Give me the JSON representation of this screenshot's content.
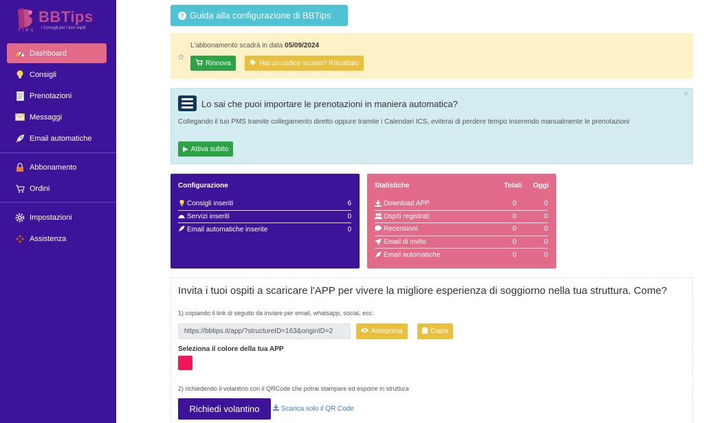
{
  "brand": {
    "name": "BBTips",
    "tagline": "i Consigli per i tuoi ospiti",
    "tips": "TIPS",
    "logo_color": "#c14c8e"
  },
  "sidebar": {
    "groups": [
      [
        {
          "label": "Dashboard",
          "icon": "dashboard-icon",
          "active": true
        },
        {
          "label": "Consigli",
          "icon": "lightbulb-icon"
        },
        {
          "label": "Prenotazioni",
          "icon": "document-icon"
        },
        {
          "label": "Messaggi",
          "icon": "envelope-icon"
        },
        {
          "label": "Email automatiche",
          "icon": "rocket-icon"
        }
      ],
      [
        {
          "label": "Abbonamento",
          "icon": "lock-icon"
        },
        {
          "label": "Ordini",
          "icon": "cart-icon"
        }
      ],
      [
        {
          "label": "Impostazioni",
          "icon": "gear-icon"
        },
        {
          "label": "Assistenza",
          "icon": "support-icon"
        }
      ]
    ]
  },
  "guide_button": "Guida alla configurazione di BBTips",
  "subscription": {
    "message": "L'abbonamento scadrà in data",
    "date": "05/09/2024",
    "renew_label": "Rinnova",
    "promo_label": "Hai un codice sconto? Riscattalo"
  },
  "import_alert": {
    "title": "Lo sai che puoi importare le prenotazioni in maniera automatica?",
    "body": "Collegando il tuo PMS tramite collegamento diretto oppure tramite i Calendari ICS, eviterai di perdere tempo inserendo manualmente le prenotazioni",
    "action_label": "Attiva subito",
    "close": "×"
  },
  "config_card": {
    "title": "Configurazione",
    "rows": [
      {
        "label": "Consigli inseriti",
        "value": "6",
        "icon": "lightbulb-icon"
      },
      {
        "label": "Servizi inseriti",
        "value": "0",
        "icon": "bell-icon"
      },
      {
        "label": "Email automatiche inserite",
        "value": "0",
        "icon": "rocket-icon"
      }
    ]
  },
  "stats_card": {
    "title": "Statistiche",
    "col_total": "Totali",
    "col_today": "Oggi",
    "rows": [
      {
        "label": "Download APP",
        "total": "0",
        "today": "0",
        "icon": "download-icon"
      },
      {
        "label": "Ospiti registrati",
        "total": "0",
        "today": "0",
        "icon": "users-icon"
      },
      {
        "label": "Recensioni",
        "total": "0",
        "today": "0",
        "icon": "comment-icon"
      },
      {
        "label": "Email di invito",
        "total": "0",
        "today": "0",
        "icon": "send-icon"
      },
      {
        "label": "Email automatiche",
        "total": "0",
        "today": "0",
        "icon": "rocket-icon"
      }
    ]
  },
  "invite": {
    "title": "Invita i tuoi ospiti a scaricare l'APP per vivere la migliore esperienza di soggiorno nella tua struttura. Come?",
    "step1": "1) copiando il link di seguito da inviare per email, whatsapp, social, ecc.",
    "link": "https://bbtips.it/app/?structureID=163&originID=2",
    "preview_label": "Anteprima",
    "copy_label": "Copia",
    "color_label": "Seleziona il colore della tua APP",
    "app_color": "#f0175a",
    "step2": "2) richiedendo il volantino con il QRCode che potrai stampare ed esporre in struttura",
    "flyer_label": "Richiedi volantino",
    "qr_label": "Scarica solo il QR Code"
  }
}
